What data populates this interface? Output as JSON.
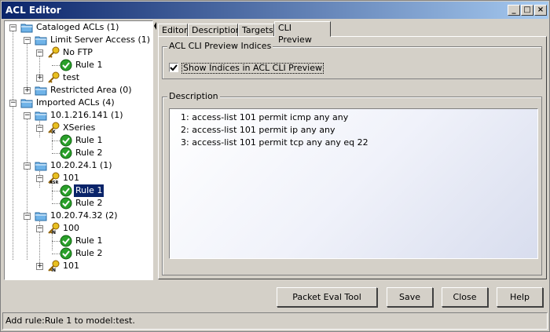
{
  "window": {
    "title": "ACL Editor",
    "minimize_glyph": "_",
    "maximize_glyph": "□",
    "close_glyph": "×"
  },
  "tree": {
    "nodes": [
      {
        "label": "Cataloged ACLs (1)",
        "icon": "folder-icon"
      },
      {
        "label": "Limit Server Access (1)",
        "icon": "folder-icon"
      },
      {
        "label": "No FTP",
        "icon": "key-icon"
      },
      {
        "label": "Rule 1",
        "icon": "check-icon"
      },
      {
        "label": "test",
        "icon": "key-icon"
      },
      {
        "label": "Restricted Area (0)",
        "icon": "folder-icon"
      },
      {
        "label": "Imported ACLs (4)",
        "icon": "folder-icon"
      },
      {
        "label": "10.1.216.141 (1)",
        "icon": "folder-icon"
      },
      {
        "label": "XSeries",
        "icon": "key-x-icon"
      },
      {
        "label": "Rule 1",
        "icon": "check-icon"
      },
      {
        "label": "Rule 2",
        "icon": "check-icon"
      },
      {
        "label": "10.20.24.1 (1)",
        "icon": "folder-icon"
      },
      {
        "label": "101",
        "icon": "key-xsr-icon"
      },
      {
        "label": "Rule 1",
        "icon": "check-icon",
        "selected": true
      },
      {
        "label": "Rule 2",
        "icon": "check-icon"
      },
      {
        "label": "10.20.74.32 (2)",
        "icon": "folder-icon"
      },
      {
        "label": "100",
        "icon": "key-n-icon"
      },
      {
        "label": "Rule 1",
        "icon": "check-icon"
      },
      {
        "label": "Rule 2",
        "icon": "check-icon"
      },
      {
        "label": "101",
        "icon": "key-n-icon"
      }
    ]
  },
  "tabs": [
    {
      "label": "Editor"
    },
    {
      "label": "Description"
    },
    {
      "label": "Targets"
    },
    {
      "label": "CLI Preview",
      "active": true
    }
  ],
  "cli_preview": {
    "indices_group_title": "ACL CLI Preview Indices",
    "show_indices_label": "Show Indices in ACL CLI Preview",
    "show_indices_checked": true,
    "description_group_title": "Description",
    "lines": [
      "1: access-list 101 permit icmp any any",
      "2: access-list 101 permit ip any any",
      "3: access-list 101 permit tcp any any eq 22"
    ]
  },
  "buttons": {
    "packet_eval": "Packet Eval Tool",
    "save": "Save",
    "close": "Close",
    "help": "Help"
  },
  "status_text": "Add rule:Rule 1 to model:test.",
  "colors": {
    "title_bar": "#0a246a",
    "window_bg": "#d4d0c8",
    "selection": "#0a246a",
    "folder": "#6fb3e8",
    "key": "#e8c020",
    "check": "#2aa02a"
  }
}
